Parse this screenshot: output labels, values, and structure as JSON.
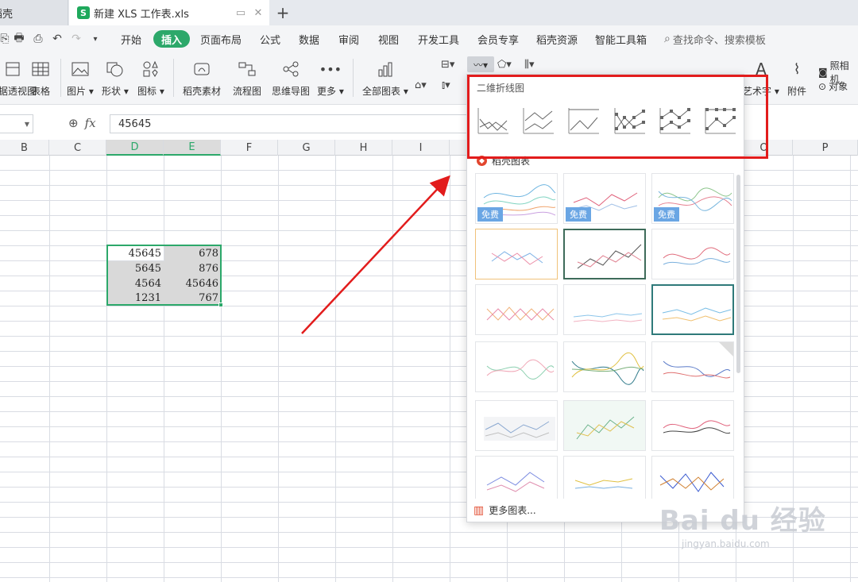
{
  "tabs": {
    "home": "稻壳",
    "file": "新建 XLS 工作表.xls",
    "add": "+"
  },
  "menu": {
    "items": [
      "开始",
      "插入",
      "页面布局",
      "公式",
      "数据",
      "审阅",
      "视图",
      "开发工具",
      "会员专享",
      "稻壳资源",
      "智能工具箱"
    ],
    "active": "插入",
    "search": "查找命令、搜索模板"
  },
  "ribbon": {
    "items": [
      "数据透视图",
      "表格",
      "图片",
      "形状",
      "图标",
      "稻壳素材",
      "流程图",
      "思维导图",
      "更多",
      "全部图表",
      "艺术字",
      "附件",
      "照相机",
      "对象"
    ]
  },
  "formula": {
    "fx": "fx",
    "value": "45645"
  },
  "sheet": {
    "columns": [
      "B",
      "C",
      "D",
      "E",
      "F",
      "G",
      "H",
      "I",
      "O",
      "P"
    ],
    "cells": [
      [
        "45645",
        "678"
      ],
      [
        "5645",
        "876"
      ],
      [
        "4564",
        "45646"
      ],
      [
        "1231",
        "767"
      ]
    ]
  },
  "chart_menu": {
    "title": "二维折线图",
    "section": "稻壳图表",
    "free_label": "免费",
    "more": "更多图表..."
  },
  "watermark": {
    "main": "Bai du 经验",
    "sub": "jingyan.baidu.com"
  },
  "colors": {
    "accent": "#2ca86a",
    "annotation": "#e21c1c",
    "free_badge": "#6aa6e4"
  }
}
